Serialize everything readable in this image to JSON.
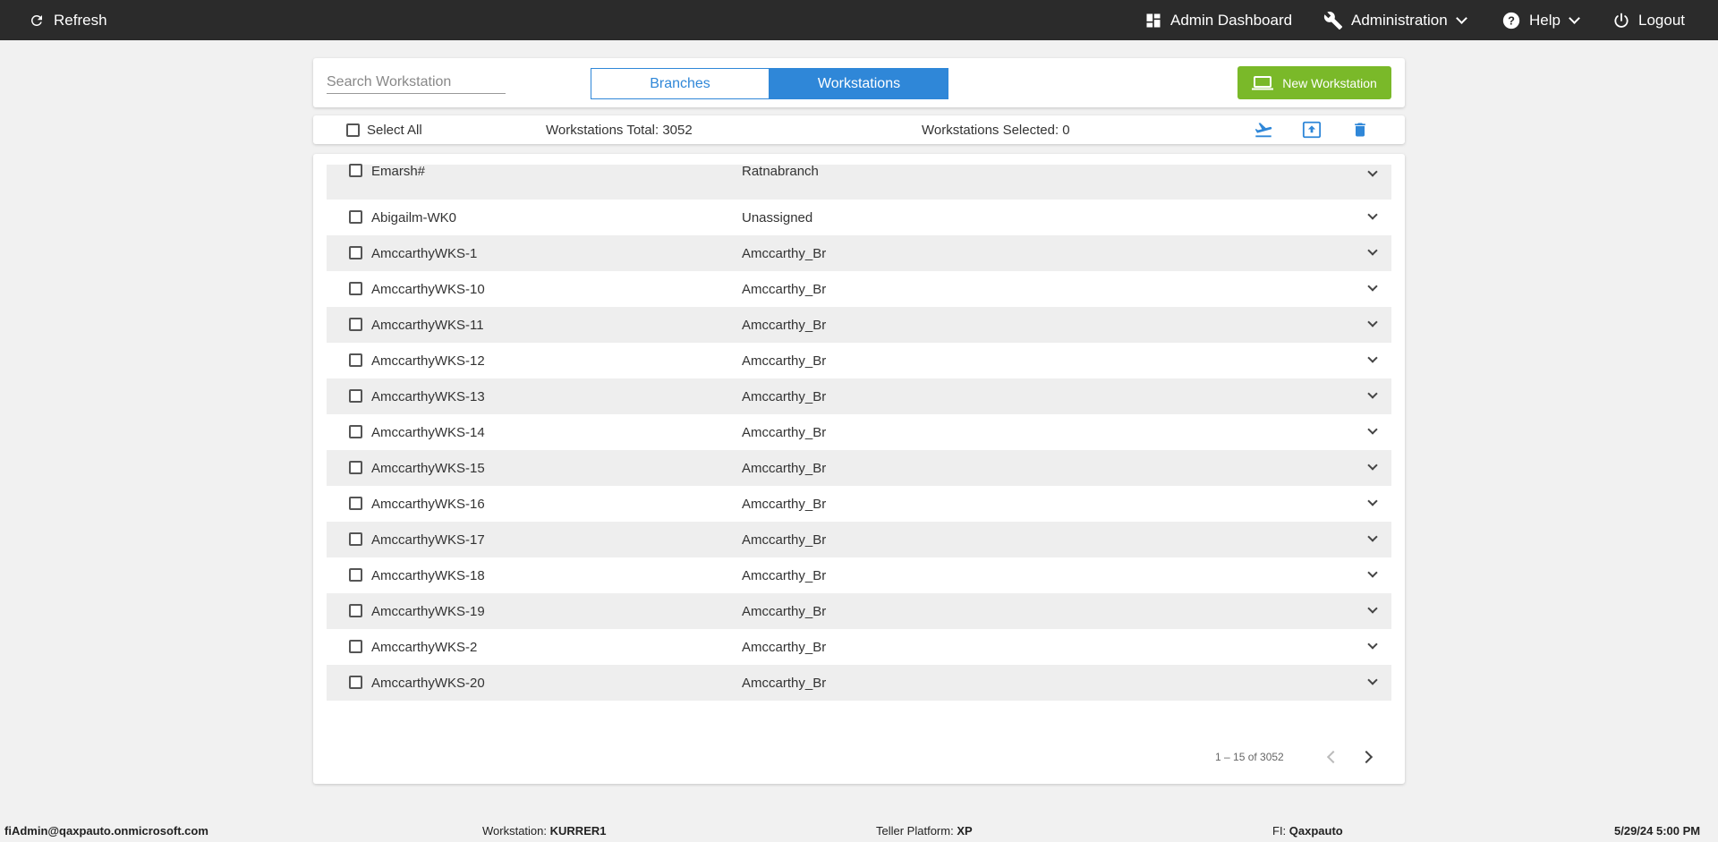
{
  "topbar": {
    "refresh_label": "Refresh",
    "admin_dashboard_label": "Admin Dashboard",
    "administration_label": "Administration",
    "help_label": "Help",
    "logout_label": "Logout"
  },
  "header": {
    "search_placeholder": "Search Workstation",
    "tabs": [
      {
        "label": "Branches",
        "active": false
      },
      {
        "label": "Workstations",
        "active": true
      }
    ],
    "new_workstation_label": "New Workstation"
  },
  "toolbar": {
    "select_all_label": "Select All",
    "total_label": "Workstations Total: 3052",
    "selected_label": "Workstations Selected: 0",
    "icons": [
      "transfer-icon",
      "upload-icon",
      "delete-icon"
    ]
  },
  "rows": [
    {
      "name": "Emarsh#",
      "branch": "Ratnabranch"
    },
    {
      "name": "Abigailm-WK0",
      "branch": "Unassigned"
    },
    {
      "name": "AmccarthyWKS-1",
      "branch": "Amccarthy_Br"
    },
    {
      "name": "AmccarthyWKS-10",
      "branch": "Amccarthy_Br"
    },
    {
      "name": "AmccarthyWKS-11",
      "branch": "Amccarthy_Br"
    },
    {
      "name": "AmccarthyWKS-12",
      "branch": "Amccarthy_Br"
    },
    {
      "name": "AmccarthyWKS-13",
      "branch": "Amccarthy_Br"
    },
    {
      "name": "AmccarthyWKS-14",
      "branch": "Amccarthy_Br"
    },
    {
      "name": "AmccarthyWKS-15",
      "branch": "Amccarthy_Br"
    },
    {
      "name": "AmccarthyWKS-16",
      "branch": "Amccarthy_Br"
    },
    {
      "name": "AmccarthyWKS-17",
      "branch": "Amccarthy_Br"
    },
    {
      "name": "AmccarthyWKS-18",
      "branch": "Amccarthy_Br"
    },
    {
      "name": "AmccarthyWKS-19",
      "branch": "Amccarthy_Br"
    },
    {
      "name": "AmccarthyWKS-2",
      "branch": "Amccarthy_Br"
    },
    {
      "name": "AmccarthyWKS-20",
      "branch": "Amccarthy_Br"
    }
  ],
  "pager": {
    "range_label": "1 – 15 of 3052"
  },
  "footer": {
    "user": "fiAdmin@qaxpauto.onmicrosoft.com",
    "workstation_label": "Workstation:",
    "workstation_value": "KURRER1",
    "platform_label": "Teller Platform:",
    "platform_value": "XP",
    "fi_label": "FI:",
    "fi_value": "Qaxpauto",
    "datetime": "5/29/24 5:00 PM"
  },
  "colors": {
    "topbar": "#2b2b2b",
    "accent_blue": "#2f87d8",
    "accent_green": "#7ab929",
    "row_alt": "#eeeeee"
  }
}
